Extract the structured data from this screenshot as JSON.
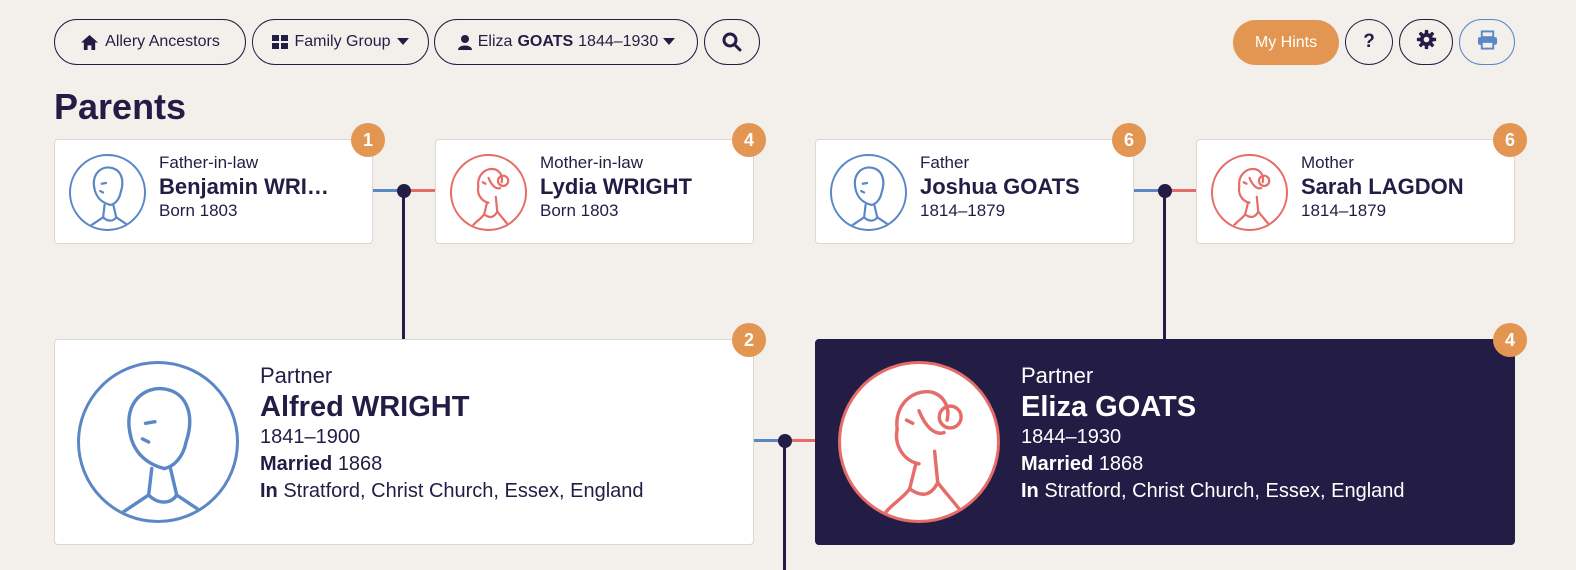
{
  "toolbar": {
    "home_label": "Allery Ancestors",
    "view_label": "Family Group",
    "person_first": "Eliza",
    "person_surname": "GOATS",
    "person_years": "1844–1930",
    "hints_label": "My Hints",
    "help_label": "?"
  },
  "page_title": "Parents",
  "parents": [
    {
      "role": "Father-in-law",
      "name": "Benjamin WRI…",
      "detail": "Born 1803",
      "badge": "1",
      "gender": "male"
    },
    {
      "role": "Mother-in-law",
      "name": "Lydia WRIGHT",
      "detail": "Born 1803",
      "badge": "4",
      "gender": "female"
    },
    {
      "role": "Father",
      "name": "Joshua GOATS",
      "detail": "1814–1879",
      "badge": "6",
      "gender": "male"
    },
    {
      "role": "Mother",
      "name": "Sarah LAGDON",
      "detail": "1814–1879",
      "badge": "6",
      "gender": "female"
    }
  ],
  "partners": [
    {
      "role": "Partner",
      "name": "Alfred WRIGHT",
      "years": "1841–1900",
      "married_label": "Married",
      "married_year": "1868",
      "place_label": "In",
      "place": "Stratford, Christ Church, Essex, England",
      "badge": "2",
      "gender": "male"
    },
    {
      "role": "Partner",
      "name": "Eliza GOATS",
      "years": "1844–1930",
      "married_label": "Married",
      "married_year": "1868",
      "place_label": "In",
      "place": "Stratford, Christ Church, Essex, England",
      "badge": "4",
      "gender": "female"
    }
  ],
  "colors": {
    "male": "#5b87c7",
    "female": "#e56c68",
    "accent": "#e39552",
    "dark": "#231d45",
    "background": "#f3f0ec"
  },
  "icons": [
    "home-icon",
    "grid-icon",
    "person-icon",
    "caret-down-icon",
    "search-icon",
    "gear-icon",
    "printer-icon"
  ]
}
